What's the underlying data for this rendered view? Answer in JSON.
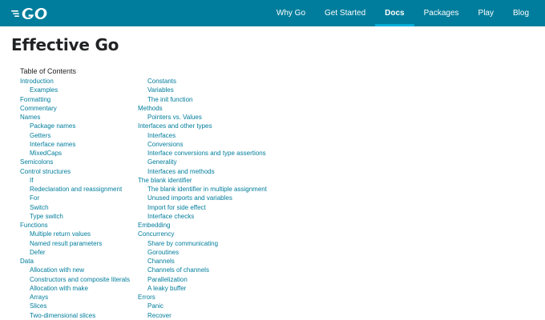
{
  "header": {
    "logo_text": "GO",
    "nav": [
      {
        "label": "Why Go",
        "active": false
      },
      {
        "label": "Get Started",
        "active": false
      },
      {
        "label": "Docs",
        "active": true
      },
      {
        "label": "Packages",
        "active": false
      },
      {
        "label": "Play",
        "active": false
      },
      {
        "label": "Blog",
        "active": false
      }
    ]
  },
  "page": {
    "title": "Effective Go",
    "toc_title": "Table of Contents"
  },
  "toc": {
    "left": [
      {
        "label": "Introduction",
        "level": 1
      },
      {
        "label": "Examples",
        "level": 2
      },
      {
        "label": "Formatting",
        "level": 1
      },
      {
        "label": "Commentary",
        "level": 1
      },
      {
        "label": "Names",
        "level": 1
      },
      {
        "label": "Package names",
        "level": 2
      },
      {
        "label": "Getters",
        "level": 2
      },
      {
        "label": "Interface names",
        "level": 2
      },
      {
        "label": "MixedCaps",
        "level": 2
      },
      {
        "label": "Semicolons",
        "level": 1
      },
      {
        "label": "Control structures",
        "level": 1
      },
      {
        "label": "If",
        "level": 2
      },
      {
        "label": "Redeclaration and reassignment",
        "level": 2
      },
      {
        "label": "For",
        "level": 2
      },
      {
        "label": "Switch",
        "level": 2
      },
      {
        "label": "Type switch",
        "level": 2
      },
      {
        "label": "Functions",
        "level": 1
      },
      {
        "label": "Multiple return values",
        "level": 2
      },
      {
        "label": "Named result parameters",
        "level": 2
      },
      {
        "label": "Defer",
        "level": 2
      },
      {
        "label": "Data",
        "level": 1
      },
      {
        "label": "Allocation with new",
        "level": 2
      },
      {
        "label": "Constructors and composite literals",
        "level": 2
      },
      {
        "label": "Allocation with make",
        "level": 2
      },
      {
        "label": "Arrays",
        "level": 2
      },
      {
        "label": "Slices",
        "level": 2
      },
      {
        "label": "Two-dimensional slices",
        "level": 2
      }
    ],
    "right": [
      {
        "label": "Constants",
        "level": 2
      },
      {
        "label": "Variables",
        "level": 2
      },
      {
        "label": "The init function",
        "level": 2
      },
      {
        "label": "Methods",
        "level": 1
      },
      {
        "label": "Pointers vs. Values",
        "level": 2
      },
      {
        "label": "Interfaces and other types",
        "level": 1
      },
      {
        "label": "Interfaces",
        "level": 2
      },
      {
        "label": "Conversions",
        "level": 2
      },
      {
        "label": "Interface conversions and type assertions",
        "level": 2
      },
      {
        "label": "Generality",
        "level": 2
      },
      {
        "label": "Interfaces and methods",
        "level": 2
      },
      {
        "label": "The blank identifier",
        "level": 1
      },
      {
        "label": "The blank identifier in multiple assignment",
        "level": 2
      },
      {
        "label": "Unused imports and variables",
        "level": 2
      },
      {
        "label": "Import for side effect",
        "level": 2
      },
      {
        "label": "Interface checks",
        "level": 2
      },
      {
        "label": "Embedding",
        "level": 1
      },
      {
        "label": "Concurrency",
        "level": 1
      },
      {
        "label": "Share by communicating",
        "level": 2
      },
      {
        "label": "Goroutines",
        "level": 2
      },
      {
        "label": "Channels",
        "level": 2
      },
      {
        "label": "Channels of channels",
        "level": 2
      },
      {
        "label": "Parallelization",
        "level": 2
      },
      {
        "label": "A leaky buffer",
        "level": 2
      },
      {
        "label": "Errors",
        "level": 1
      },
      {
        "label": "Panic",
        "level": 2
      },
      {
        "label": "Recover",
        "level": 2
      }
    ]
  },
  "colors": {
    "header_bg": "#007d9c",
    "active_underline": "#00add8",
    "link": "#007d9c",
    "text": "#202224"
  },
  "icons": {
    "logo": "go-logo-icon"
  }
}
